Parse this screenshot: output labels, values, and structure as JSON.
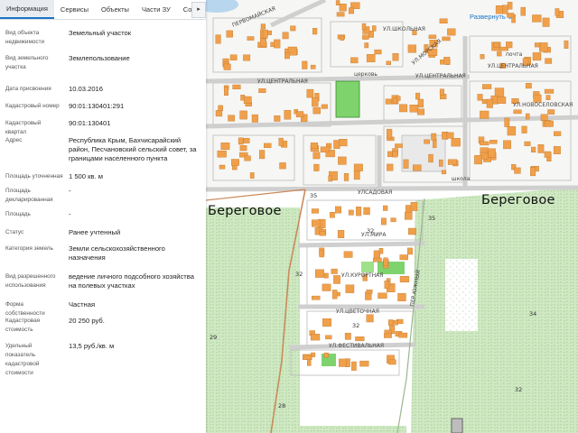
{
  "tabs": [
    {
      "label": "Информация"
    },
    {
      "label": "Сервисы"
    },
    {
      "label": "Объекты"
    },
    {
      "label": "Части ЗУ"
    },
    {
      "label": "Состав"
    }
  ],
  "tabs_more_icon": "chevron-right-icon",
  "info": [
    {
      "label": "Вид объекта недвижимости",
      "value": "Земельный участок"
    },
    {
      "label": "Вид земельного участка",
      "value": "Землепользование"
    },
    {
      "label": "Дата присвоения",
      "value": "10.03.2016"
    },
    {
      "label": "Кадастровый номер",
      "value": "90:01:130401:291"
    },
    {
      "label": "Кадастровый квартал",
      "value": "90:01:130401"
    },
    {
      "label": "Адрес",
      "value": "Республика Крым, Бахчисарайский район, Песчановский сельский совет, за границами населенного пункта"
    },
    {
      "label": "Площадь уточненная",
      "value": "1 500 кв. м"
    },
    {
      "label": "Площадь декларированная",
      "value": "-"
    },
    {
      "label": "Площадь",
      "value": "-"
    },
    {
      "label": "Статус",
      "value": "Ранее учтенный"
    },
    {
      "label": "Категория земель",
      "value": "Земли сельскохозяйственного назначения"
    },
    {
      "label": "Вид разрешенного использования",
      "value": "ведение личного подсобного хозяйства на полевых участках"
    },
    {
      "label": "Форма собственности",
      "value": "Частная"
    },
    {
      "label": "Кадастровая стоимость",
      "value": "20 250 руб."
    },
    {
      "label": "Удельный показатель кадастровой стоимости",
      "value": "13,5 руб./кв. м"
    }
  ],
  "map": {
    "expand_label": "Развернуть",
    "expand_icon": "chevron-down-icon",
    "places": [
      "Береговое",
      "Береговое"
    ],
    "streets": [
      "ПЕРВОМАЙСКАЯ",
      "УЛ.ШКОЛЬНАЯ",
      "УЛ.ЦЕНТРАЛЬНАЯ",
      "УЛ.ЦЕНТРАЛЬНАЯ",
      "УЛ.ЦЕНТРАЛЬНАЯ",
      "УЛ.МОРСКАЯ",
      "УЛ.НОВОСЕЛОВСКАЯ",
      "УЛСАДОВАЯ",
      "УЛ.МИРА",
      "УЛ.КУРОРТНАЯ",
      "УЛ.ЦВЕТОЧНАЯ",
      "УЛ.ФЕСТИВАЛЬНАЯ",
      "ПЕР.ЮЖНЫЙ",
      "почта",
      "школа",
      "церковь"
    ],
    "parcel_numbers": [
      "35",
      "35",
      "32",
      "32",
      "32",
      "29",
      "34",
      "28",
      "32"
    ]
  },
  "colors": {
    "accent": "#1a73c9",
    "building": "#f0a04b",
    "green": "#cfe9c2",
    "bright_green": "#7fd36d",
    "road": "#c98a5a"
  }
}
